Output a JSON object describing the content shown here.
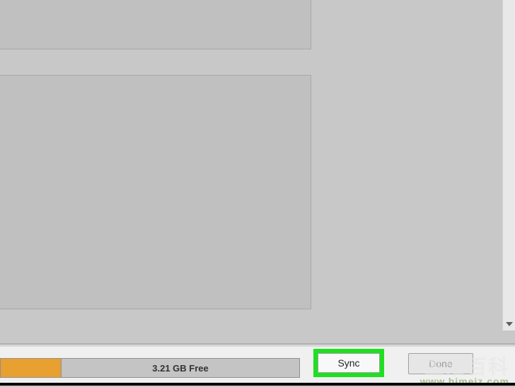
{
  "storage": {
    "free_label": "3.21 GB Free"
  },
  "buttons": {
    "sync_label": "Sync",
    "done_label": "Done"
  },
  "watermark": {
    "text": "生活百科",
    "url": "www.bimeiz.com"
  }
}
